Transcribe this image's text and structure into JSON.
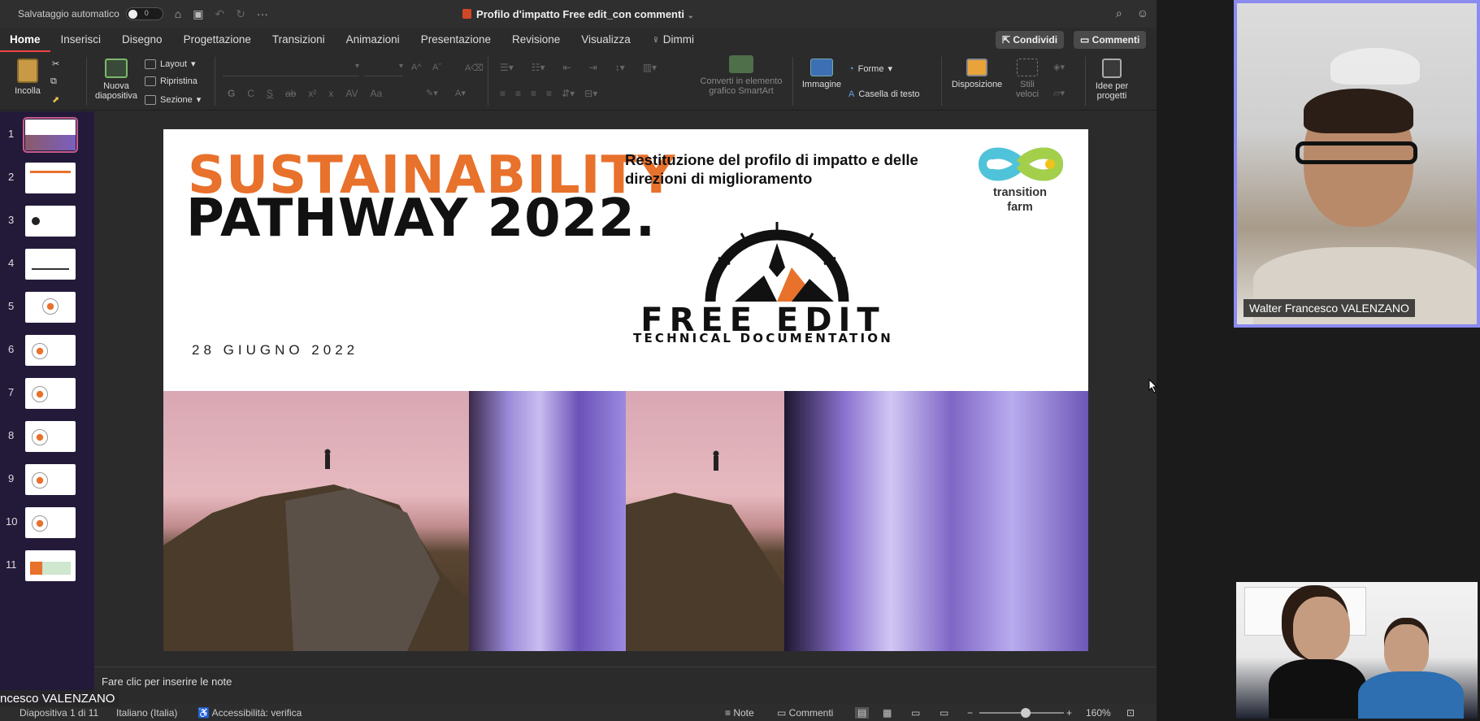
{
  "titlebar": {
    "autosave_label": "Salvataggio automatico",
    "autosave_value": "0",
    "doc_title": "Profilo d'impatto Free edit_con commenti"
  },
  "menu": {
    "tabs": [
      "Home",
      "Inserisci",
      "Disegno",
      "Progettazione",
      "Transizioni",
      "Animazioni",
      "Presentazione",
      "Revisione",
      "Visualizza",
      "Dimmi"
    ],
    "share_label": "Condividi",
    "comments_label": "Commenti"
  },
  "ribbon": {
    "paste": "Incolla",
    "new_slide": "Nuova diapositiva",
    "layout": "Layout",
    "reset": "Ripristina",
    "section": "Sezione",
    "bold": "G",
    "italic": "C",
    "underline": "S",
    "strike": "ab",
    "superscript": "x²",
    "subscript": "x",
    "spacing": "AV",
    "case": "Aa",
    "smartart": "Converti in elemento grafico SmartArt",
    "image": "Immagine",
    "shapes": "Forme",
    "textbox": "Casella di testo",
    "arrange": "Disposizione",
    "quick_styles": "Stili veloci",
    "designer": "Idee per progetti"
  },
  "slides": {
    "numbers": [
      "1",
      "2",
      "3",
      "4",
      "5",
      "6",
      "7",
      "8",
      "9",
      "10",
      "11"
    ],
    "selected": 1
  },
  "slide": {
    "title1": "SUSTAINABILITY",
    "title2": "PATHWAY 2022.",
    "subtitle": "Restituzione del profilo di impatto e delle direzioni di miglioramento",
    "date": "28 GIUGNO 2022",
    "logo_text": "transition farm",
    "fe_title": "FREE EDIT",
    "fe_subtitle": "TECHNICAL DOCUMENTATION"
  },
  "notes": {
    "placeholder": "Fare clic per inserire le note"
  },
  "statusbar": {
    "slide_info": "Diapositiva 1 di 11",
    "language": "Italiano (Italia)",
    "accessibility": "Accessibilità: verifica",
    "notes_btn": "Note",
    "comments_btn": "Commenti",
    "zoom": "160%"
  },
  "meeting": {
    "participant_main": "Walter Francesco VALENZANO",
    "presenter_label": "ncesco VALENZANO"
  },
  "colors": {
    "accent_orange": "#e8712c",
    "thumb_panel": "#231a3a",
    "active_speaker": "#8b8bf0"
  }
}
